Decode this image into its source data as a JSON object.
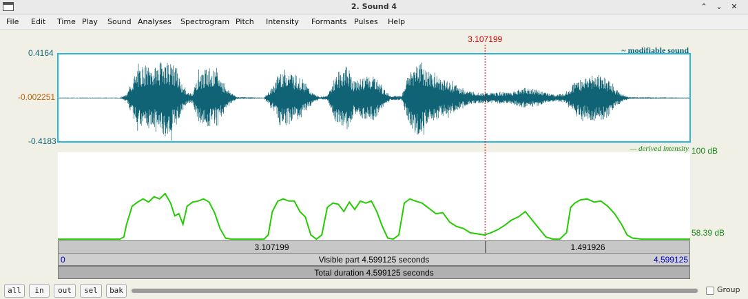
{
  "window": {
    "title": "2. Sound 4",
    "controls": [
      "⌃",
      "⌄",
      "✕"
    ]
  },
  "menu": [
    "File",
    "Edit",
    "Time",
    "Play",
    "Sound",
    "Analyses",
    "Spectrogram",
    "Pitch",
    "Intensity",
    "Formants",
    "Pulses",
    "Help"
  ],
  "cursor": {
    "time": "3.107199",
    "time_value": 3.107199
  },
  "sound": {
    "label": "~ modifiable sound",
    "ymax": "0.4164",
    "ymid": "-0.002251",
    "ymin": "-0.4183"
  },
  "intensity": {
    "label": "— derived intensity",
    "top": "100 dB",
    "bottom": "58.39 dB"
  },
  "bars": {
    "left_duration": "3.107199",
    "right_duration": "1.491926",
    "visible_start": "0",
    "visible_label": "Visible part 4.599125 seconds",
    "visible_end": "4.599125",
    "total": "Total duration 4.599125 seconds"
  },
  "buttons": [
    "all",
    "in",
    "out",
    "sel",
    "bak"
  ],
  "group_label": "Group",
  "colors": {
    "waveform": "#0f6374",
    "waveform_box": "#29b6e0",
    "intensity": "#22cc00",
    "cursor": "#cc0000",
    "ylabel_top": "#0f6374",
    "ylabel_mid": "#c06000",
    "db_label": "#1a8c1a",
    "visible_end": "#0000cc"
  },
  "chart_data": [
    {
      "type": "line",
      "title": "~ modifiable sound",
      "xlabel": "",
      "ylabel": "",
      "xlim": [
        0,
        4.599125
      ],
      "ylim": [
        -0.4183,
        0.4164
      ],
      "series": [
        {
          "name": "~ modifiable sound",
          "envelope": [
            [
              0.0,
              0.004
            ],
            [
              0.45,
              0.004
            ],
            [
              0.5,
              0.03
            ],
            [
              0.55,
              0.2
            ],
            [
              0.62,
              0.32
            ],
            [
              0.7,
              0.28
            ],
            [
              0.78,
              0.38
            ],
            [
              0.85,
              0.3
            ],
            [
              0.9,
              0.14
            ],
            [
              0.94,
              0.05
            ],
            [
              0.98,
              0.05
            ],
            [
              1.02,
              0.22
            ],
            [
              1.1,
              0.3
            ],
            [
              1.18,
              0.2
            ],
            [
              1.24,
              0.08
            ],
            [
              1.3,
              0.01
            ],
            [
              1.5,
              0.004
            ],
            [
              1.56,
              0.1
            ],
            [
              1.62,
              0.28
            ],
            [
              1.7,
              0.25
            ],
            [
              1.78,
              0.18
            ],
            [
              1.85,
              0.05
            ],
            [
              1.9,
              0.01
            ],
            [
              1.96,
              0.02
            ],
            [
              2.02,
              0.22
            ],
            [
              2.1,
              0.32
            ],
            [
              2.16,
              0.15
            ],
            [
              2.22,
              0.2
            ],
            [
              2.3,
              0.22
            ],
            [
              2.36,
              0.1
            ],
            [
              2.42,
              0.02
            ],
            [
              2.5,
              0.02
            ],
            [
              2.55,
              0.24
            ],
            [
              2.62,
              0.38
            ],
            [
              2.7,
              0.25
            ],
            [
              2.8,
              0.18
            ],
            [
              2.9,
              0.12
            ],
            [
              2.98,
              0.07
            ],
            [
              3.05,
              0.05
            ],
            [
              3.2,
              0.05
            ],
            [
              3.3,
              0.06
            ],
            [
              3.4,
              0.1
            ],
            [
              3.48,
              0.08
            ],
            [
              3.55,
              0.05
            ],
            [
              3.62,
              0.03
            ],
            [
              3.7,
              0.05
            ],
            [
              3.76,
              0.16
            ],
            [
              3.85,
              0.2
            ],
            [
              3.95,
              0.24
            ],
            [
              4.0,
              0.18
            ],
            [
              4.05,
              0.1
            ],
            [
              4.1,
              0.04
            ],
            [
              4.16,
              0.008
            ],
            [
              4.599125,
              0.004
            ]
          ]
        }
      ]
    },
    {
      "type": "line",
      "title": "— derived intensity",
      "xlabel": "",
      "ylabel": "",
      "xlim": [
        0,
        4.599125
      ],
      "ylim": [
        58.39,
        100
      ],
      "series": [
        {
          "name": "— derived intensity",
          "x": [
            0.0,
            0.45,
            0.48,
            0.5,
            0.54,
            0.58,
            0.62,
            0.66,
            0.7,
            0.74,
            0.78,
            0.82,
            0.85,
            0.88,
            0.91,
            0.94,
            0.98,
            1.02,
            1.06,
            1.1,
            1.14,
            1.18,
            1.22,
            1.26,
            1.3,
            1.36,
            1.5,
            1.53,
            1.56,
            1.6,
            1.64,
            1.68,
            1.72,
            1.76,
            1.8,
            1.84,
            1.88,
            1.92,
            1.96,
            2.0,
            2.04,
            2.08,
            2.12,
            2.16,
            2.2,
            2.24,
            2.28,
            2.32,
            2.36,
            2.4,
            2.44,
            2.48,
            2.52,
            2.56,
            2.6,
            2.65,
            2.7,
            2.75,
            2.8,
            2.85,
            2.9,
            2.95,
            3.0,
            3.05,
            3.1,
            3.15,
            3.2,
            3.25,
            3.3,
            3.35,
            3.4,
            3.45,
            3.5,
            3.55,
            3.6,
            3.65,
            3.7,
            3.73,
            3.76,
            3.8,
            3.85,
            3.9,
            3.95,
            4.0,
            4.05,
            4.1,
            4.14,
            4.18,
            4.25,
            4.599125
          ],
          "y": [
            59.0,
            59.0,
            60.0,
            66.0,
            74.5,
            76.5,
            78.0,
            76.5,
            79.0,
            78.0,
            80.5,
            76.0,
            70.0,
            71.0,
            66.0,
            74.5,
            76.5,
            77.0,
            78.0,
            76.5,
            71.5,
            64.0,
            59.5,
            59.0,
            59.0,
            59.0,
            59.0,
            61.0,
            72.0,
            77.0,
            78.0,
            77.0,
            77.0,
            72.0,
            69.5,
            61.0,
            59.0,
            61.0,
            74.0,
            76.0,
            75.5,
            72.0,
            76.5,
            73.0,
            77.0,
            76.0,
            77.0,
            72.0,
            65.0,
            59.5,
            59.0,
            61.0,
            76.0,
            78.0,
            77.0,
            76.0,
            73.5,
            71.0,
            71.5,
            67.0,
            65.0,
            64.0,
            62.0,
            61.5,
            61.0,
            62.0,
            63.5,
            65.5,
            68.0,
            69.5,
            72.0,
            68.0,
            64.0,
            60.0,
            59.0,
            59.0,
            62.0,
            74.0,
            76.0,
            77.5,
            78.0,
            76.5,
            77.0,
            74.5,
            71.0,
            66.0,
            61.0,
            59.5,
            59.0,
            59.0
          ]
        }
      ]
    }
  ]
}
